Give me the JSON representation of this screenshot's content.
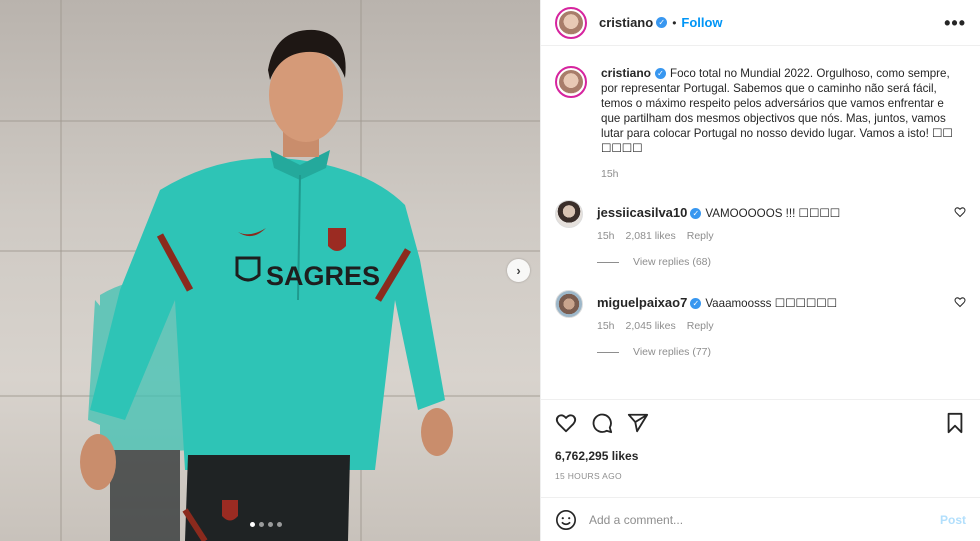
{
  "header": {
    "username": "cristiano",
    "separator": "•",
    "follow_label": "Follow",
    "more_label": "•••"
  },
  "caption": {
    "username": "cristiano",
    "text": "Foco total no Mundial 2022. Orgulhoso, como sempre, por representar Portugal. Sabemos que o caminho não será fácil, temos o máximo respeito pelos adversários que vamos enfrentar e que partilham dos mesmos objectivos que nós. Mas, juntos, vamos lutar para colocar Portugal no nosso devido lugar. Vamos a isto! ☐☐ ☐☐☐☐",
    "time": "15h"
  },
  "comments": [
    {
      "username": "jessiicasilva10",
      "verified": true,
      "text": "VAMOOOOOS !!! ☐☐☐☐",
      "time": "15h",
      "likes": "2,081 likes",
      "reply_label": "Reply",
      "view_replies": "View replies (68)"
    },
    {
      "username": "miguelpaixao7",
      "verified": true,
      "text": "Vaaamoosss ☐☐☐☐☐☐",
      "time": "15h",
      "likes": "2,045 likes",
      "reply_label": "Reply",
      "view_replies": "View replies (77)"
    }
  ],
  "actions": {
    "likes": "6,762,295 likes",
    "posted_ago": "15 HOURS AGO"
  },
  "add_comment": {
    "placeholder": "Add a comment...",
    "post_label": "Post"
  },
  "media": {
    "next_label": "›",
    "carousel_total": 4,
    "carousel_active": 1,
    "shirt_sponsor": "SAGRES"
  },
  "colors": {
    "accent": "#0095f6",
    "verified": "#3897f0",
    "jersey": "#2ec4b6",
    "muted": "#8e8e8e"
  }
}
